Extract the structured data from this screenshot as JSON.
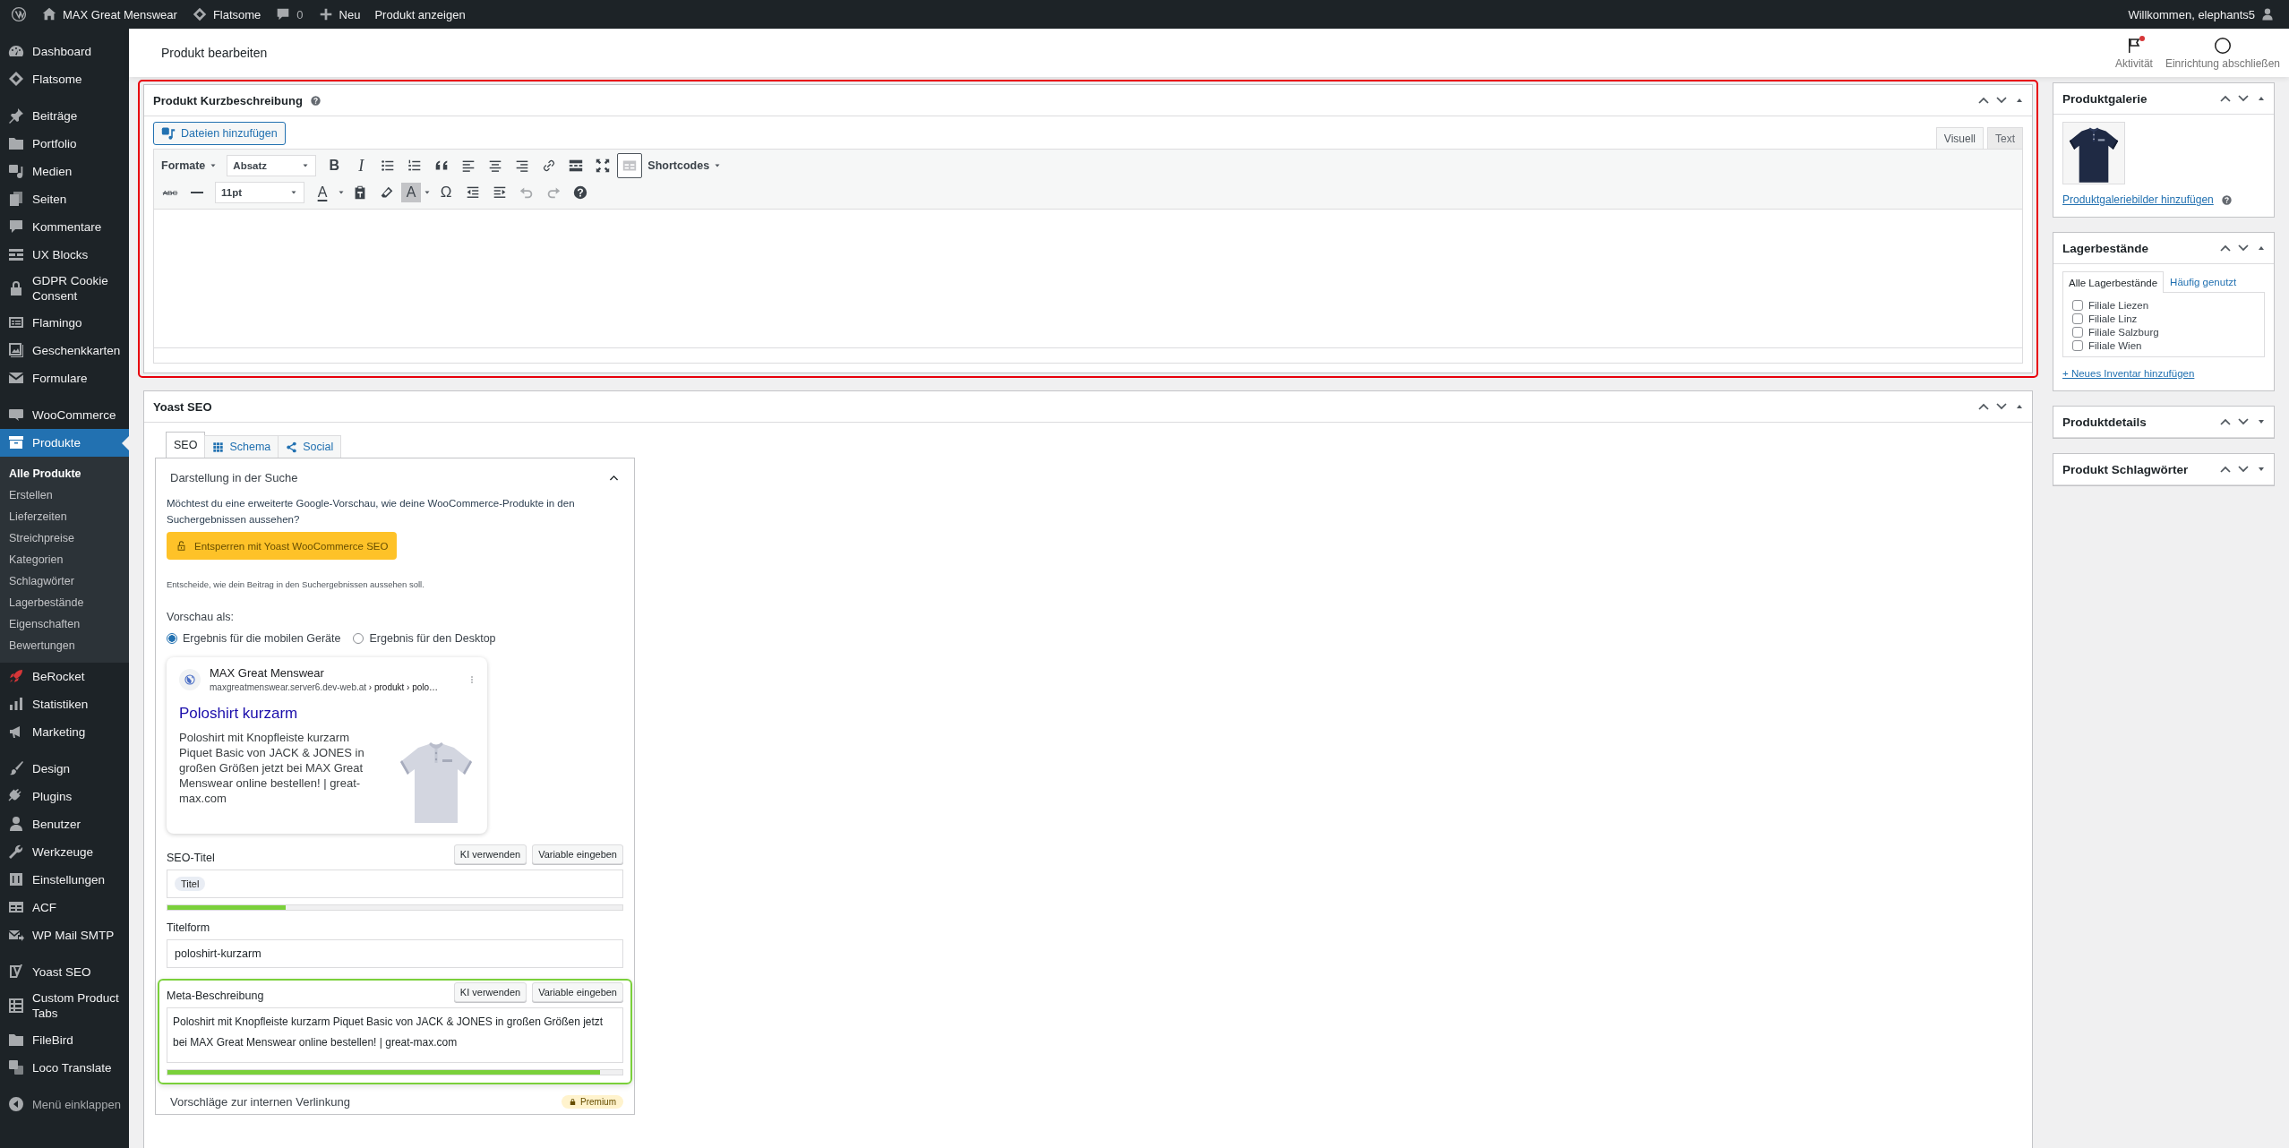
{
  "admin_bar": {
    "site_name": "MAX Great Menswear",
    "theme": "Flatsome",
    "comment_count": "0",
    "new_label": "Neu",
    "view_label": "Produkt anzeigen",
    "greeting": "Willkommen, elephants5"
  },
  "sidebar": {
    "groups": [
      {
        "items": [
          {
            "label": "Dashboard",
            "selected": false
          },
          {
            "label": "Flatsome",
            "selected": false
          }
        ]
      },
      {
        "items": [
          {
            "label": "Beiträge",
            "selected": false
          },
          {
            "label": "Portfolio",
            "selected": false
          },
          {
            "label": "Medien",
            "selected": false
          },
          {
            "label": "Seiten",
            "selected": false
          },
          {
            "label": "Kommentare",
            "selected": false
          },
          {
            "label": "UX Blocks",
            "selected": false
          },
          {
            "label": "GDPR Cookie Consent",
            "selected": false
          },
          {
            "label": "Flamingo",
            "selected": false
          },
          {
            "label": "Geschenkkarten",
            "selected": false
          },
          {
            "label": "Formulare",
            "selected": false
          }
        ]
      },
      {
        "items": [
          {
            "label": "WooCommerce",
            "selected": false
          },
          {
            "label": "Produkte",
            "selected": true,
            "submenu": [
              {
                "label": "Alle Produkte",
                "selected": true
              },
              {
                "label": "Erstellen",
                "selected": false
              },
              {
                "label": "Lieferzeiten",
                "selected": false
              },
              {
                "label": "Streichpreise",
                "selected": false
              },
              {
                "label": "Kategorien",
                "selected": false
              },
              {
                "label": "Schlagwörter",
                "selected": false
              },
              {
                "label": "Lagerbestände",
                "selected": false
              },
              {
                "label": "Eigenschaften",
                "selected": false
              },
              {
                "label": "Bewertungen",
                "selected": false
              }
            ]
          },
          {
            "label": "BeRocket",
            "selected": false
          },
          {
            "label": "Statistiken",
            "selected": false
          },
          {
            "label": "Marketing",
            "selected": false
          }
        ]
      },
      {
        "items": [
          {
            "label": "Design",
            "selected": false
          },
          {
            "label": "Plugins",
            "selected": false
          },
          {
            "label": "Benutzer",
            "selected": false
          },
          {
            "label": "Werkzeuge",
            "selected": false
          },
          {
            "label": "Einstellungen",
            "selected": false
          },
          {
            "label": "ACF",
            "selected": false
          },
          {
            "label": "WP Mail SMTP",
            "selected": false
          }
        ]
      },
      {
        "items": [
          {
            "label": "Yoast SEO",
            "selected": false
          },
          {
            "label": "Custom Product Tabs",
            "selected": false
          },
          {
            "label": "FileBird",
            "selected": false
          },
          {
            "label": "Loco Translate",
            "selected": false
          }
        ]
      }
    ],
    "collapse_label": "Menü einklappen"
  },
  "header": {
    "title": "Produkt bearbeiten",
    "actions": [
      {
        "label": "Aktivität",
        "unread": true
      },
      {
        "label": "Einrichtung abschließen",
        "unread": false
      }
    ]
  },
  "short_description": {
    "title": "Produkt Kurzbeschreibung",
    "expanded": true,
    "highlighted": true,
    "add_media": "Dateien hinzufügen",
    "editor_tabs": [
      {
        "label": "Visuell",
        "selected": true
      },
      {
        "label": "Text",
        "selected": false
      }
    ],
    "toolbar": {
      "formats": "Formate",
      "block_format": "Absatz",
      "bold": "B",
      "italic": "I",
      "shortcodes": "Shortcodes",
      "strikethrough": "ABC",
      "font_size": "11pt",
      "text_color": "A",
      "background_color": "A",
      "special_character": "Ω",
      "undo_disabled": true,
      "redo_disabled": true
    }
  },
  "yoast": {
    "title": "Yoast SEO",
    "expanded": true,
    "tabs": [
      {
        "label": "SEO",
        "selected": true
      },
      {
        "label": "Schema",
        "selected": false
      },
      {
        "label": "Social",
        "selected": false
      }
    ],
    "search_appearance": {
      "title": "Darstellung in der Suche",
      "expanded": true,
      "upsell_text": "Möchtest du eine erweiterte Google-Vorschau, wie deine WooCommerce-Produkte in den Suchergebnissen aussehen?",
      "upsell_button": "Entsperren mit Yoast WooCommerce SEO",
      "hint": "Entscheide, wie dein Beitrag in den Suchergebnissen aussehen soll.",
      "preview_label": "Vorschau als:",
      "preview_modes": [
        {
          "label": "Ergebnis für die mobilen Geräte",
          "selected": true
        },
        {
          "label": "Ergebnis für den Desktop",
          "selected": false
        }
      ],
      "preview": {
        "site_name": "MAX Great Menswear",
        "url": "maxgreatmenswear.server6.dev-web.at",
        "breadcrumb": "› produkt › polo…",
        "title": "Poloshirt kurzarm",
        "description": "Poloshirt mit Knopfleiste kurzarm Piquet Basic von JACK & JONES in großen Größen jetzt bei MAX Great Menswear online bestellen! | great-max.com"
      }
    },
    "fields": [
      {
        "kind": "tag",
        "label": "SEO-Titel",
        "buttons": [
          "KI verwenden",
          "Variable eingeben"
        ],
        "value": "Titel",
        "level": 0.26
      },
      {
        "kind": "text",
        "label": "Titelform",
        "value": "poloshirt-kurzarm"
      },
      {
        "kind": "textarea",
        "label": "Meta-Beschreibung",
        "buttons": [
          "KI verwenden",
          "Variable eingeben"
        ],
        "value": "Poloshirt mit Knopfleiste kurzarm Piquet Basic von JACK & JONES in großen Größen jetzt bei MAX Great Menswear online bestellen! | great-max.com",
        "level": 0.95,
        "highlighted": true
      }
    ],
    "linking": {
      "title": "Vorschläge zur internen Verlinkung",
      "badge": "Premium"
    }
  },
  "side_boxes": [
    {
      "kind": "gallery",
      "title": "Produktgalerie",
      "expanded": true,
      "link": "Produktgaleriebilder hinzufügen"
    },
    {
      "kind": "stock",
      "title": "Lagerbestände",
      "expanded": true,
      "tabs": [
        {
          "label": "Alle Lagerbestände",
          "selected": true
        },
        {
          "label": "Häufig genutzt",
          "selected": false
        }
      ],
      "options": [
        {
          "label": "Filiale Liezen",
          "checked": false
        },
        {
          "label": "Filiale Linz",
          "checked": false
        },
        {
          "label": "Filiale Salzburg",
          "checked": false
        },
        {
          "label": "Filiale Wien",
          "checked": false
        }
      ],
      "link": "+ Neues Inventar hinzufügen"
    },
    {
      "kind": "plain",
      "title": "Produktdetails",
      "expanded": false
    },
    {
      "kind": "plain",
      "title": "Produkt Schlagwörter",
      "expanded": false
    }
  ]
}
